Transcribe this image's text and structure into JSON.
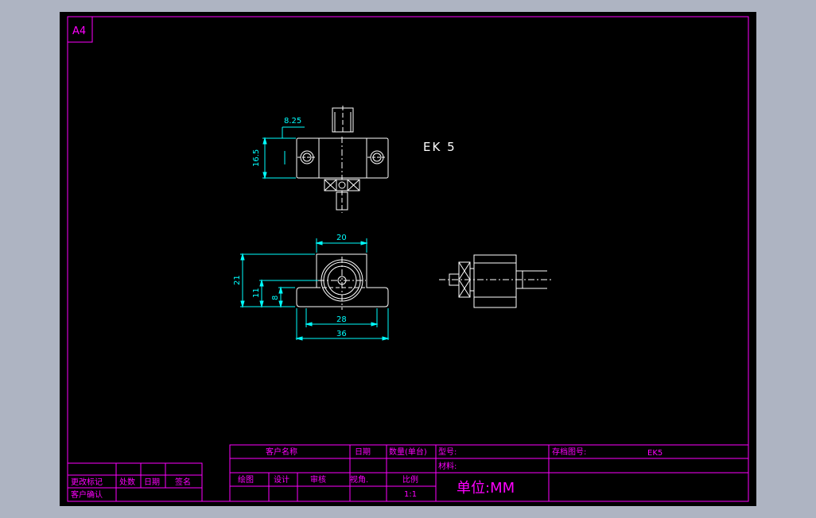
{
  "sheet": {
    "size_label": "A4",
    "part_label": "EK 5"
  },
  "dimensions": {
    "d_8_25": "8.25",
    "d_16_5": "16.5",
    "d_20": "20",
    "d_21": "21",
    "d_11": "11",
    "d_8": "8",
    "d_28": "28",
    "d_36": "36"
  },
  "title_block": {
    "customer_name": "客户名称",
    "date": "日期",
    "quantity": "数量(单台)",
    "model_no": "型号:",
    "archive_no": "存档图号:",
    "archive_value": "EK5",
    "material": "材料:",
    "drawing": "绘图",
    "design": "设计",
    "review": "审核",
    "view_angle": "视角.",
    "scale": "比例",
    "scale_value": "1:1",
    "unit": "单位:MM"
  },
  "revision_block": {
    "change_mark": "更改标记",
    "location": "处数",
    "date": "日期",
    "signature": "签名",
    "customer_confirm": "客户确认"
  },
  "colors": {
    "frame": "#ff00ff",
    "geometry": "#ffffff",
    "dimension": "#00ffff",
    "background": "#000000",
    "surround": "#aeb4c2"
  }
}
